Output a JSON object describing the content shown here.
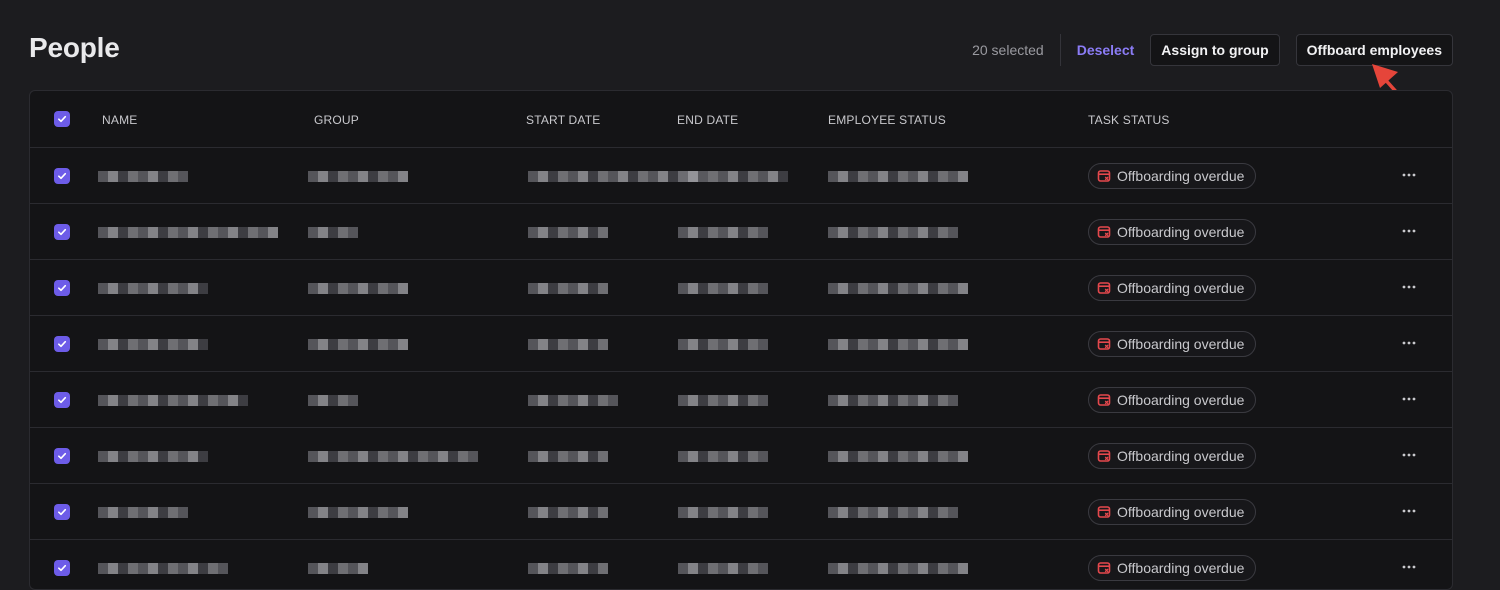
{
  "page": {
    "title": "People"
  },
  "toolbar": {
    "selected_text": "20 selected",
    "deselect_label": "Deselect",
    "assign_label": "Assign to group",
    "offboard_label": "Offboard employees"
  },
  "table": {
    "columns": [
      "NAME",
      "GROUP",
      "START DATE",
      "END DATE",
      "EMPLOYEE STATUS",
      "TASK STATUS"
    ],
    "rows": [
      {
        "task_status": "Offboarding overdue"
      },
      {
        "task_status": "Offboarding overdue"
      },
      {
        "task_status": "Offboarding overdue"
      },
      {
        "task_status": "Offboarding overdue"
      },
      {
        "task_status": "Offboarding overdue"
      },
      {
        "task_status": "Offboarding overdue"
      },
      {
        "task_status": "Offboarding overdue"
      },
      {
        "task_status": "Offboarding overdue"
      }
    ]
  },
  "colors": {
    "accent": "#6d5ce8",
    "link": "#8b7cf6",
    "overdue_icon": "#e5484d",
    "annotation_arrow": "#e5453a"
  },
  "icons": {
    "checkbox": "checkmark-icon",
    "task_status": "calendar-overdue-icon",
    "row_menu": "more-horizontal-icon"
  }
}
